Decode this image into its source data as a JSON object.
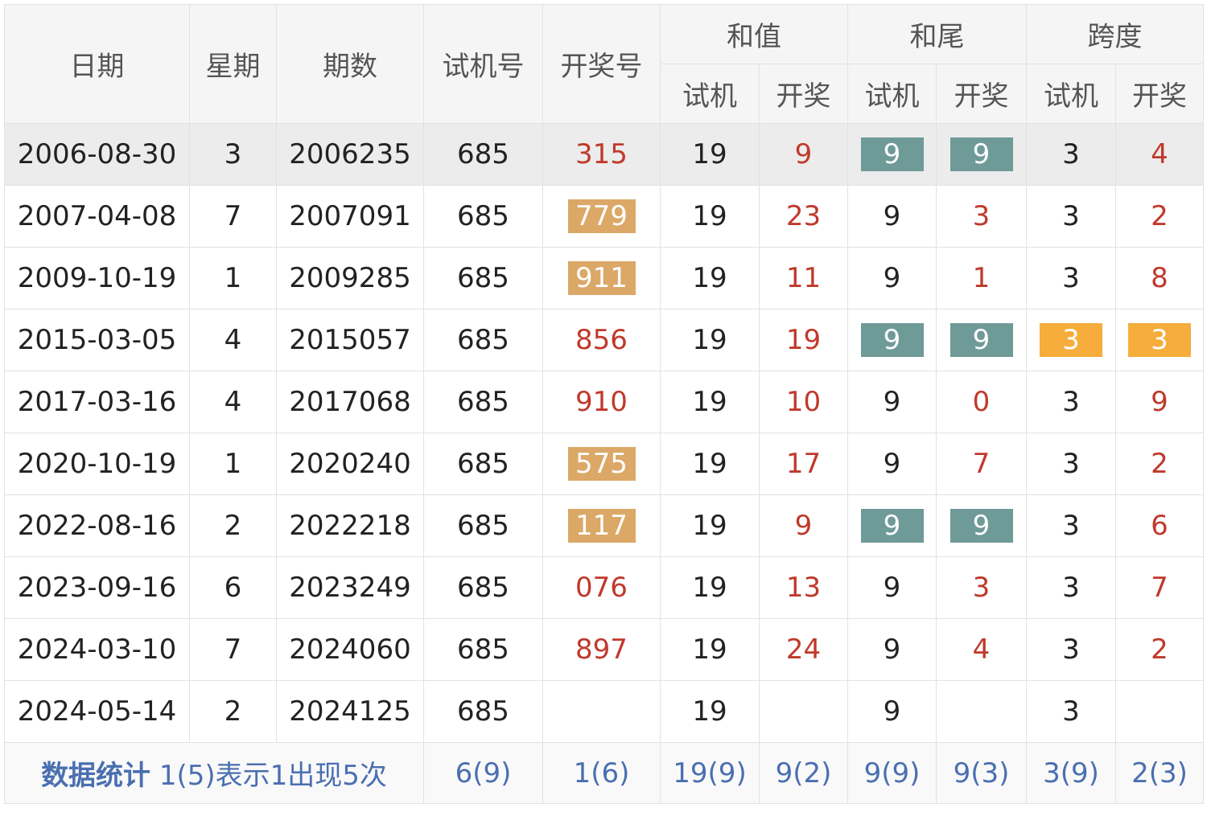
{
  "header": {
    "date": "日期",
    "weekday": "星期",
    "issue": "期数",
    "trial": "试机号",
    "draw": "开奖号",
    "sum": "和值",
    "tail": "和尾",
    "span": "跨度",
    "sub_trial": "试机",
    "sub_draw": "开奖"
  },
  "colors": {
    "highlight_draw": "#dba867",
    "match_tail": "#6e9a98",
    "match_span": "#f6ad3c",
    "draw_text": "#c0392b",
    "stat_text": "#4a6fb0"
  },
  "rows": [
    {
      "date": "2006-08-30",
      "weekday": "3",
      "issue": "2006235",
      "trial": "685",
      "draw": "315",
      "sum_trial": "19",
      "sum_draw": "9",
      "tail_trial": "9",
      "tail_draw": "9",
      "span_trial": "3",
      "span_draw": "4"
    },
    {
      "date": "2007-04-08",
      "weekday": "7",
      "issue": "2007091",
      "trial": "685",
      "draw": "779",
      "sum_trial": "19",
      "sum_draw": "23",
      "tail_trial": "9",
      "tail_draw": "3",
      "span_trial": "3",
      "span_draw": "2"
    },
    {
      "date": "2009-10-19",
      "weekday": "1",
      "issue": "2009285",
      "trial": "685",
      "draw": "911",
      "sum_trial": "19",
      "sum_draw": "11",
      "tail_trial": "9",
      "tail_draw": "1",
      "span_trial": "3",
      "span_draw": "8"
    },
    {
      "date": "2015-03-05",
      "weekday": "4",
      "issue": "2015057",
      "trial": "685",
      "draw": "856",
      "sum_trial": "19",
      "sum_draw": "19",
      "tail_trial": "9",
      "tail_draw": "9",
      "span_trial": "3",
      "span_draw": "3"
    },
    {
      "date": "2017-03-16",
      "weekday": "4",
      "issue": "2017068",
      "trial": "685",
      "draw": "910",
      "sum_trial": "19",
      "sum_draw": "10",
      "tail_trial": "9",
      "tail_draw": "0",
      "span_trial": "3",
      "span_draw": "9"
    },
    {
      "date": "2020-10-19",
      "weekday": "1",
      "issue": "2020240",
      "trial": "685",
      "draw": "575",
      "sum_trial": "19",
      "sum_draw": "17",
      "tail_trial": "9",
      "tail_draw": "7",
      "span_trial": "3",
      "span_draw": "2"
    },
    {
      "date": "2022-08-16",
      "weekday": "2",
      "issue": "2022218",
      "trial": "685",
      "draw": "117",
      "sum_trial": "19",
      "sum_draw": "9",
      "tail_trial": "9",
      "tail_draw": "9",
      "span_trial": "3",
      "span_draw": "6"
    },
    {
      "date": "2023-09-16",
      "weekday": "6",
      "issue": "2023249",
      "trial": "685",
      "draw": "076",
      "sum_trial": "19",
      "sum_draw": "13",
      "tail_trial": "9",
      "tail_draw": "3",
      "span_trial": "3",
      "span_draw": "7"
    },
    {
      "date": "2024-03-10",
      "weekday": "7",
      "issue": "2024060",
      "trial": "685",
      "draw": "897",
      "sum_trial": "19",
      "sum_draw": "24",
      "tail_trial": "9",
      "tail_draw": "4",
      "span_trial": "3",
      "span_draw": "2"
    },
    {
      "date": "2024-05-14",
      "weekday": "2",
      "issue": "2024125",
      "trial": "685",
      "draw": "",
      "sum_trial": "19",
      "sum_draw": "",
      "tail_trial": "9",
      "tail_draw": "",
      "span_trial": "3",
      "span_draw": ""
    }
  ],
  "stats": {
    "label": "数据统计",
    "note": "1(5)表示1出现5次",
    "trial": "6(9)",
    "draw": "1(6)",
    "sum_trial": "19(9)",
    "sum_draw": "9(2)",
    "tail_trial": "9(9)",
    "tail_draw": "9(3)",
    "span_trial": "3(9)",
    "span_draw": "2(3)"
  }
}
